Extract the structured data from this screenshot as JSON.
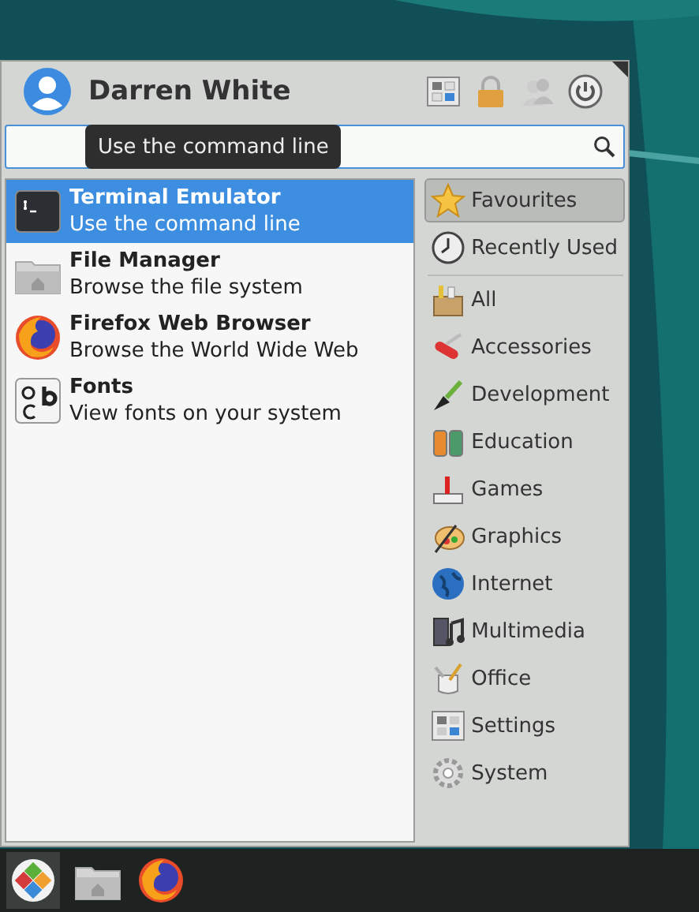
{
  "header": {
    "user_name": "Darren White"
  },
  "search": {
    "tooltip": "Use the command line"
  },
  "apps": [
    {
      "name": "Terminal Emulator",
      "description": "Use the command line",
      "selected": true
    },
    {
      "name": "File Manager",
      "description": "Browse the file system",
      "selected": false
    },
    {
      "name": "Firefox Web Browser",
      "description": "Browse the World Wide Web",
      "selected": false
    },
    {
      "name": "Fonts",
      "description": "View fonts on your system",
      "selected": false
    }
  ],
  "pinned": [
    {
      "label": "Favourites",
      "selected": true
    },
    {
      "label": "Recently Used",
      "selected": false
    }
  ],
  "categories": [
    {
      "label": "All",
      "selected": false
    },
    {
      "label": "Accessories",
      "selected": false
    },
    {
      "label": "Development",
      "selected": false
    },
    {
      "label": "Education",
      "selected": false
    },
    {
      "label": "Games",
      "selected": false
    },
    {
      "label": "Graphics",
      "selected": false
    },
    {
      "label": "Internet",
      "selected": false
    },
    {
      "label": "Multimedia",
      "selected": false
    },
    {
      "label": "Office",
      "selected": false
    },
    {
      "label": "Settings",
      "selected": false
    },
    {
      "label": "System",
      "selected": false
    }
  ]
}
